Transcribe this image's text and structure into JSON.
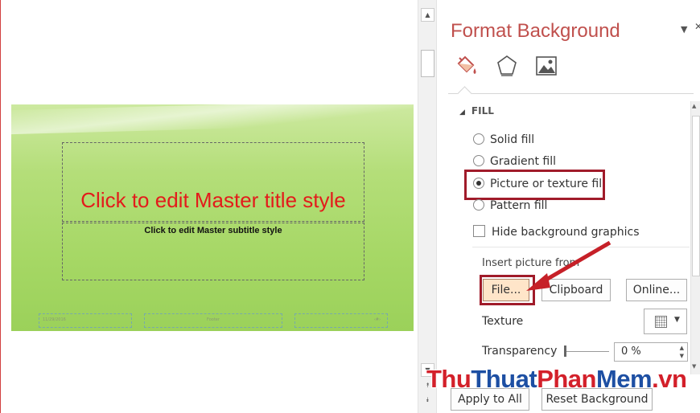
{
  "slide": {
    "title": "Click to edit Master title style",
    "subtitle": "Click to edit Master subtitle style",
    "footer_date": "11/29/2016",
    "footer_text": "Footer",
    "footer_number": "‹#›"
  },
  "pane": {
    "title": "Format Background",
    "tabs": [
      "fill-icon",
      "effects-icon",
      "picture-icon"
    ],
    "fill_section": "FILL",
    "options": {
      "solid_fill": "Solid fill",
      "gradient_fill": "Gradient fill",
      "picture_fill": "Picture or texture fill",
      "pattern_fill": "Pattern fill"
    },
    "selected_option": "Picture or texture fill",
    "hide_background_graphics": "Hide background graphics",
    "hide_background_checked": false,
    "insert_picture_from": "Insert picture from",
    "buttons": {
      "file": "File...",
      "clipboard": "Clipboard",
      "online": "Online..."
    },
    "texture_label": "Texture",
    "transparency_label": "Transparency",
    "transparency_value": "0 %",
    "apply_all": "Apply to All",
    "reset": "Reset Background"
  },
  "colors": {
    "accent": "#c0504d",
    "highlight": "#a01b2a",
    "slide_green": "#a5d764",
    "title_red": "#e31b1b"
  },
  "watermark": {
    "part1": "Thu",
    "part2": "Thuat",
    "part3": "Phan",
    "part4": "Mem",
    "part5": ".vn"
  }
}
